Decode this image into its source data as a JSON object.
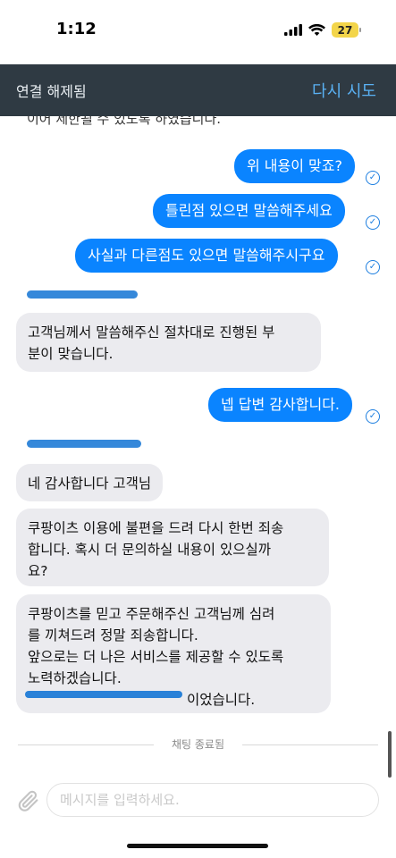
{
  "status_bar": {
    "time": "1:12",
    "battery": "27"
  },
  "header": {
    "connection_status": "연결 해제됨",
    "retry_label": "다시 시도"
  },
  "messages": {
    "clipped_top": "이어 제한될 수 있도록 하였습니다.",
    "out": [
      "위 내용이 맞죠?",
      "틀린점 있으면 말씀해주세요",
      "사실과 다른점도 있으면 말씀해주시구요",
      "넵 답변 감사합니다."
    ],
    "in_1_line1": "고객님께서 말씀해주신 절차대로 진행된 부",
    "in_1_line2": "분이 맞습니다.",
    "in_2": "네 감사합니다 고객님",
    "in_3_line1": "쿠팡이츠 이용에 불편을 드려 다시 한번 죄송",
    "in_3_line2": "합니다. 혹시 더 문의하실 내용이 있으실까",
    "in_3_line3": "요?",
    "in_4_line1": "쿠팡이츠를 믿고 주문해주신 고객님께 심려",
    "in_4_line2": "를 끼쳐드려 정말 죄송합니다.",
    "in_4_line3": "앞으로는 더 나은 서비스를 제공할 수 있도록",
    "in_4_line4": "노력하겠습니다.",
    "in_4_line5_end": "이었습니다."
  },
  "divider": {
    "label": "채팅 종료됨"
  },
  "composer": {
    "placeholder": "메시지를 입력하세요."
  }
}
